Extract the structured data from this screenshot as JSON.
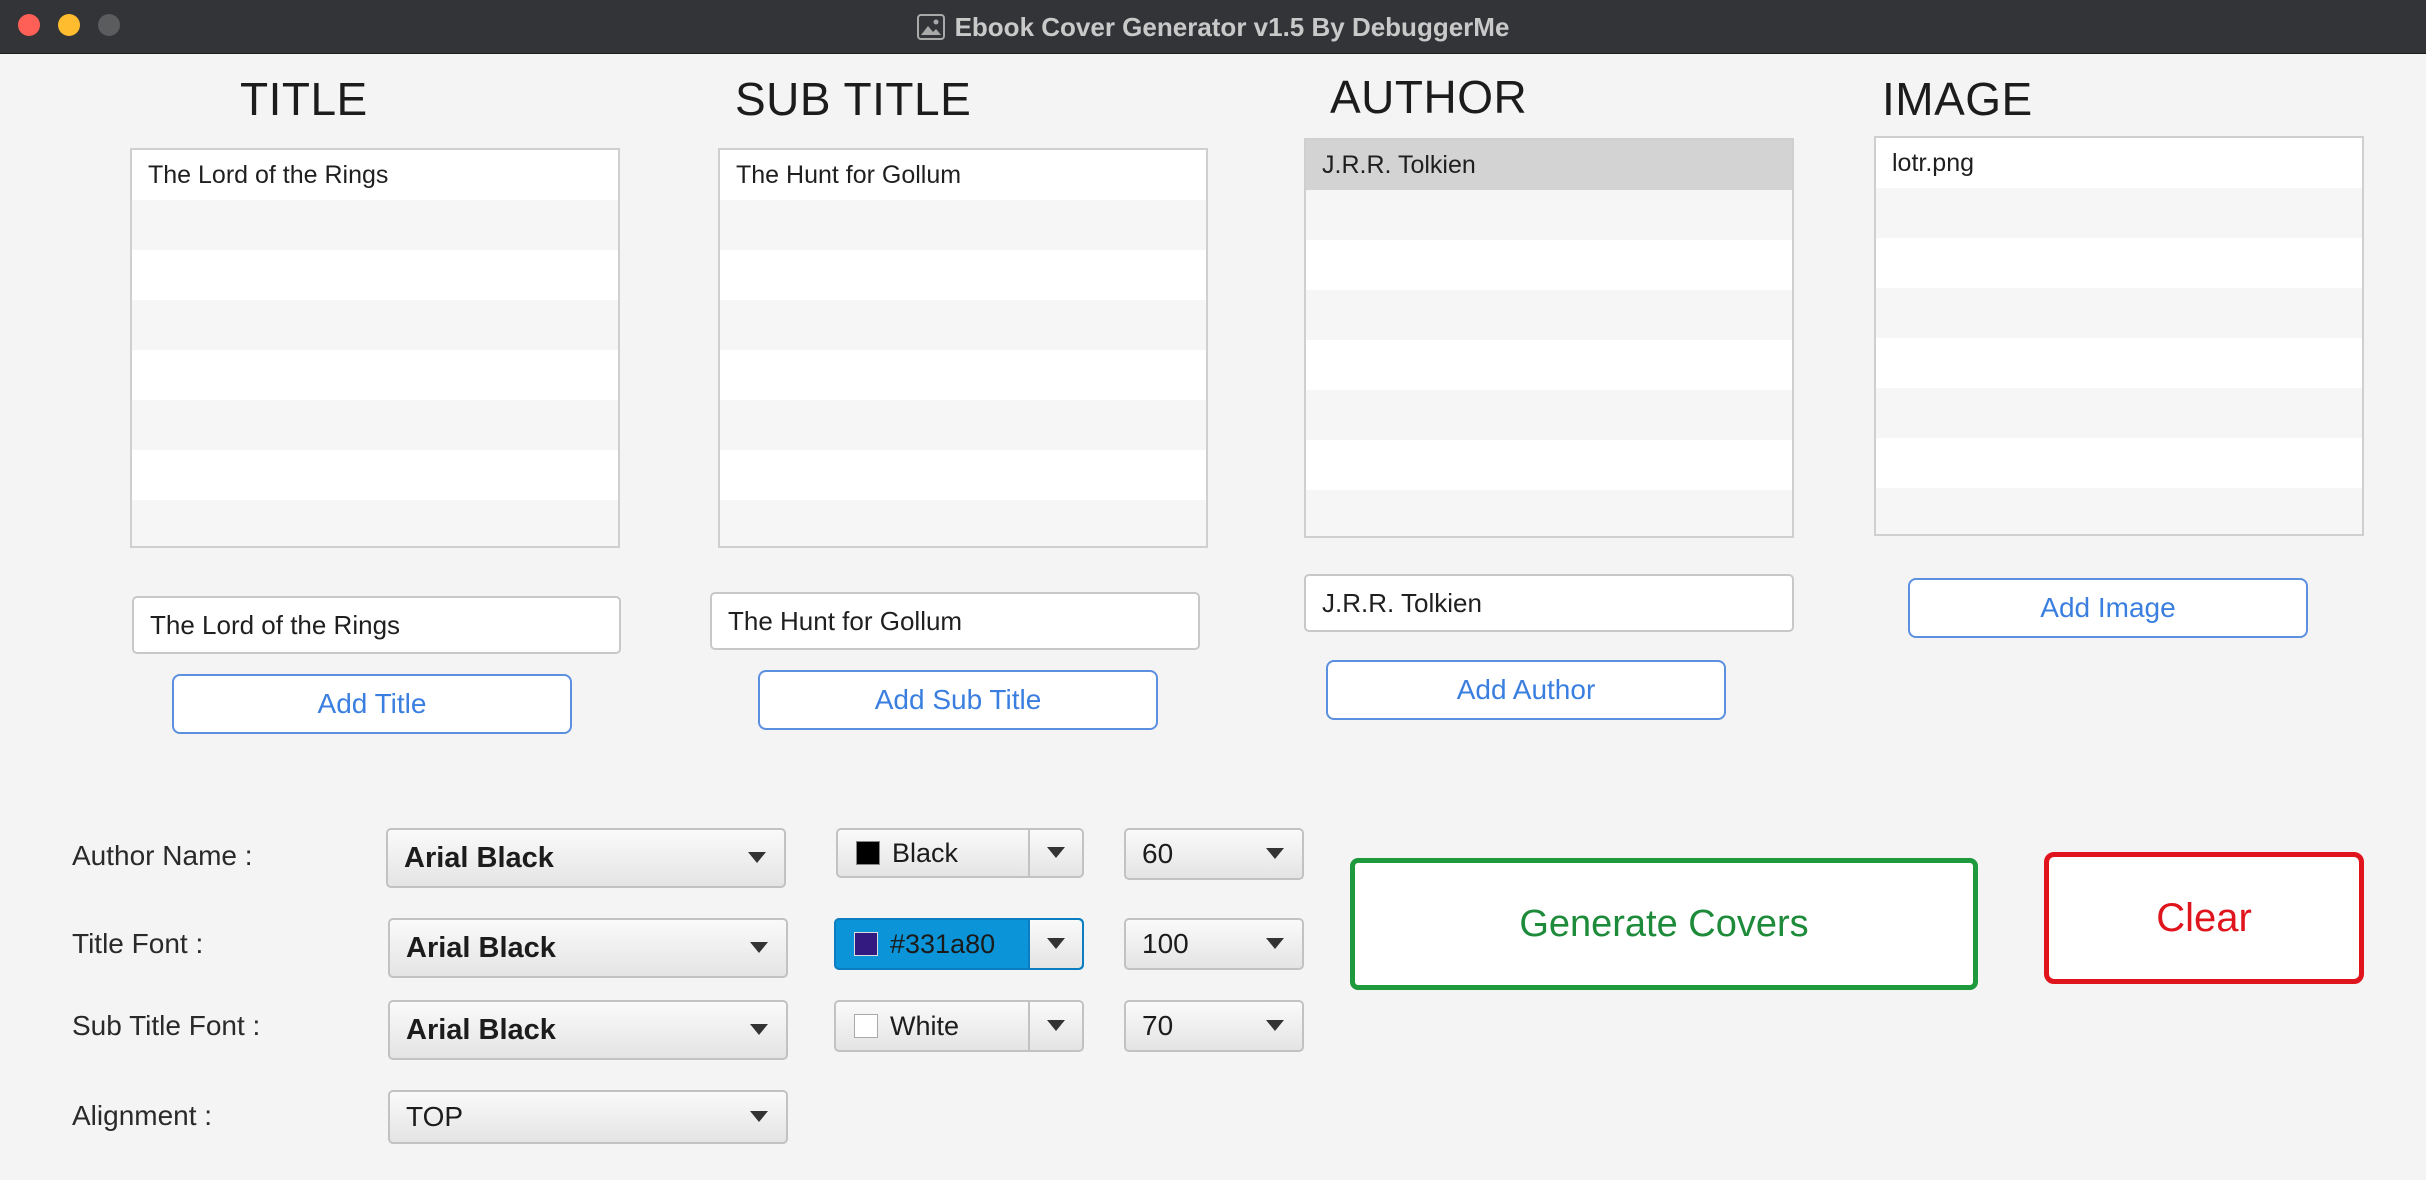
{
  "window": {
    "title": "Ebook Cover Generator v1.5 By DebuggerMe"
  },
  "columns": {
    "title": {
      "heading": "TITLE",
      "items": [
        "The Lord of the Rings"
      ],
      "input_value": "The Lord of the Rings",
      "button": "Add Title"
    },
    "subtitle": {
      "heading": "SUB TITLE",
      "items": [
        "The Hunt for Gollum"
      ],
      "input_value": "The Hunt for Gollum",
      "button": "Add Sub Title"
    },
    "author": {
      "heading": "AUTHOR",
      "items": [
        "J.R.R. Tolkien"
      ],
      "selected_index": 0,
      "input_value": "J.R.R. Tolkien",
      "button": "Add Author"
    },
    "image": {
      "heading": "IMAGE",
      "items": [
        "lotr.png"
      ],
      "button": "Add Image"
    }
  },
  "settings": {
    "author_name": {
      "label": "Author Name :",
      "font": "Arial Black",
      "color_name": "Black",
      "color_hex": "#000000",
      "size": "60"
    },
    "title_font": {
      "label": "Title Font :",
      "font": "Arial Black",
      "color_name": "#331a80",
      "color_hex": "#331a80",
      "size": "100",
      "color_active": true
    },
    "subtitle_font": {
      "label": "Sub Title Font :",
      "font": "Arial Black",
      "color_name": "White",
      "color_hex": "#ffffff",
      "size": "70"
    },
    "alignment": {
      "label": "Alignment :",
      "value": "TOP"
    }
  },
  "actions": {
    "generate": "Generate Covers",
    "clear": "Clear"
  }
}
